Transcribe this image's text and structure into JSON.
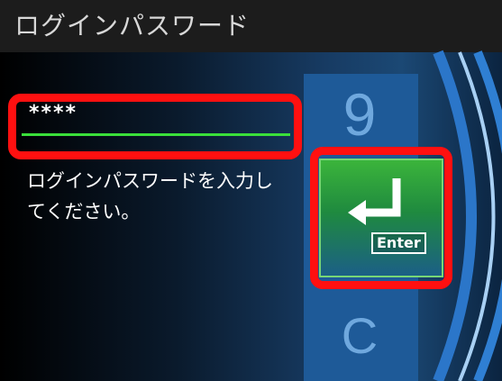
{
  "header": {
    "title": "ログインパスワード"
  },
  "login_form": {
    "password_value": "****",
    "instruction": "ログインパスワードを入力してください。"
  },
  "keypad": {
    "digit_above": "9",
    "enter_label": "Enter",
    "clear_label": "C"
  },
  "colors": {
    "highlight": "#ff1010",
    "input_underline": "#3ae03a",
    "enter_button": "#2a9c3c",
    "key_column": "#1e5a98"
  },
  "icons": {
    "enter": "enter-return-arrow-icon"
  }
}
